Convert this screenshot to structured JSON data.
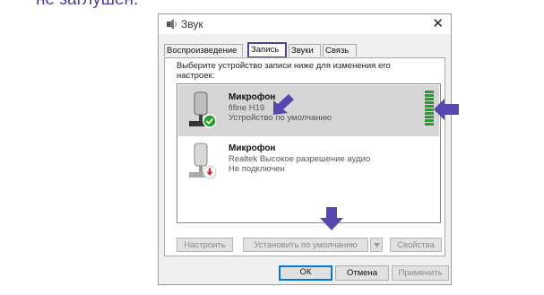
{
  "caption": "не заглушен.",
  "dialog": {
    "title": "Звук",
    "close_glyph": "✕",
    "icon": "speaker-icon"
  },
  "tabs": [
    {
      "label": "Воспроизведение",
      "active": false
    },
    {
      "label": "Запись",
      "active": true
    },
    {
      "label": "Звуки",
      "active": false
    },
    {
      "label": "Связь",
      "active": false
    }
  ],
  "instruction": "Выберите устройство записи ниже для изменения его настроек:",
  "devices": [
    {
      "name": "Микрофон",
      "model": "fifine H19",
      "status": "Устройство по умолчанию",
      "badge": "check-icon",
      "selected": true,
      "level_bars": 10
    },
    {
      "name": "Микрофон",
      "model": "Realtek Высокое разрешение аудио",
      "status": "Не подключен",
      "badge": "disconnected-icon",
      "selected": false
    }
  ],
  "buttons": {
    "configure": "Настроить",
    "set_default": "Установить по умолчанию",
    "properties": "Свойства",
    "ok": "ОК",
    "cancel": "Отмена",
    "apply": "Применить"
  },
  "colors": {
    "annotation": "#5546b0",
    "tab_highlight": "#4c3fa0",
    "level_meter": "#22a228",
    "badge_ok": "#22a228",
    "badge_error": "#d42121"
  }
}
